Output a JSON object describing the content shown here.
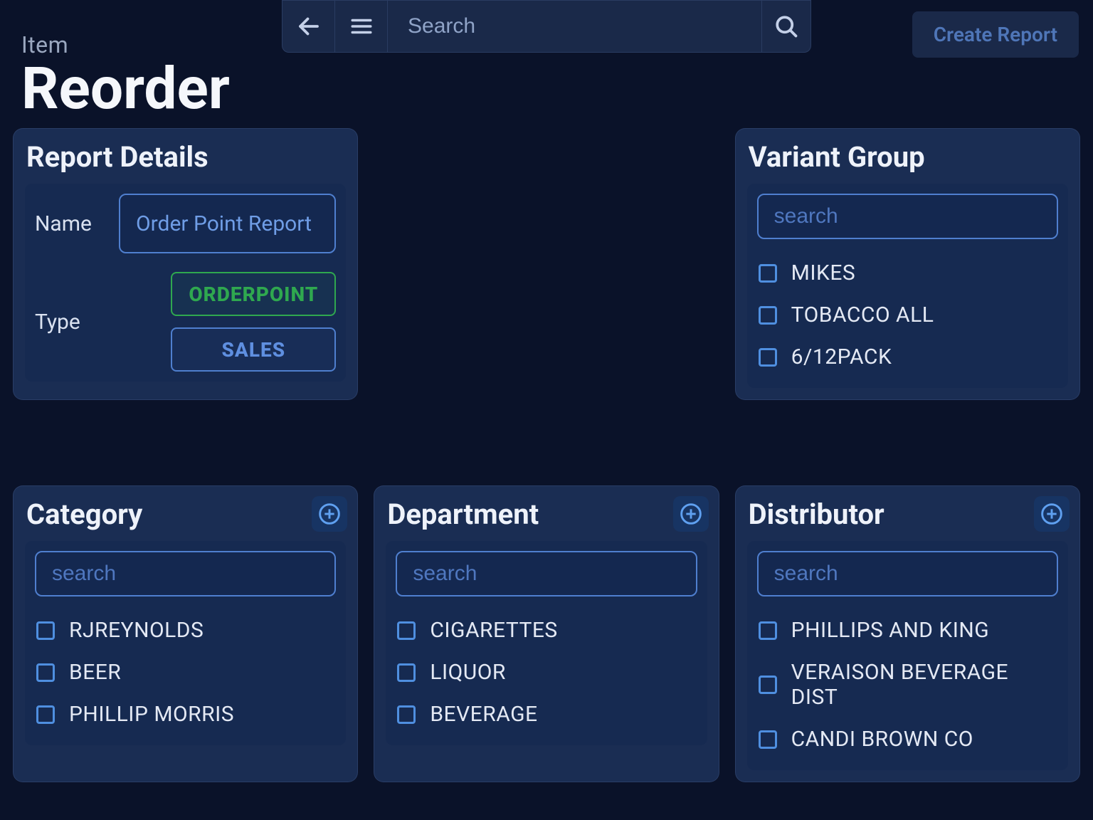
{
  "topbar": {
    "search_placeholder": "Search"
  },
  "create_report_label": "Create Report",
  "header": {
    "section": "Item",
    "title": "Reorder"
  },
  "report_details": {
    "title": "Report Details",
    "name_label": "Name",
    "name_value": "Order Point Report",
    "type_label": "Type",
    "types": [
      {
        "label": "ORDERPOINT",
        "active": true
      },
      {
        "label": "SALES",
        "active": false
      }
    ]
  },
  "variant_group": {
    "title": "Variant Group",
    "search_placeholder": "search",
    "items": [
      "MIKES",
      "TOBACCO ALL",
      "6/12PACK"
    ]
  },
  "category": {
    "title": "Category",
    "search_placeholder": "search",
    "items": [
      "RJREYNOLDS",
      "BEER",
      "PHILLIP MORRIS"
    ]
  },
  "department": {
    "title": "Department",
    "search_placeholder": "search",
    "items": [
      "CIGARETTES",
      "LIQUOR",
      "BEVERAGE"
    ]
  },
  "distributor": {
    "title": "Distributor",
    "search_placeholder": "search",
    "items": [
      "PHILLIPS AND KING",
      "VERAISON BEVERAGE DIST",
      "CANDI BROWN CO"
    ]
  }
}
